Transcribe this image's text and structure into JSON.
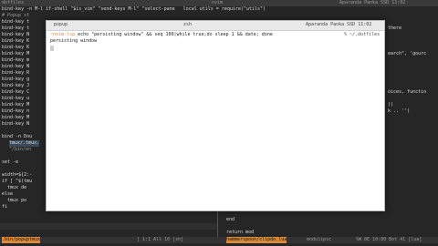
{
  "top_bar": {
    "left": "dotfiles",
    "center": "nvim",
    "right": "Aparanda Panka SSD 11:02"
  },
  "left_pane": [
    "bind-key -n M-l if-shell \"$is_vim\" \"send-keys M-l\" \"select-pane   local utils = require(\"utils\")",
    "# Popup st",
    "bind-key t",
    "bind-key t",
    "bind-key N",
    "bind-key K",
    "bind-key K",
    "bind-key M",
    "bind-key m",
    "bind-key N",
    "bind-key R",
    "bind-key g",
    "bind-key J",
    "bind-key C",
    "bind-key u",
    "bind-key M",
    "bind-key n",
    "bind-key M",
    "bind-key N",
    "",
    "bind -n Dou",
    "tmux/.tmux.",
    "\"/bin/en",
    "set -e",
    "width=${2:-",
    "if [ \"$(tmu",
    "  tmux de",
    "else",
    "  tmux po",
    "fi"
  ],
  "right_pane": [
    "there",
    "earch\", 'gourc",
    "oices, functio",
    "))",
    "k .. '')"
  ],
  "bottom_pane": [
    "end",
    "return mod"
  ],
  "status": {
    "left_mid": "",
    "left_pos": "",
    "bottom_left": ".bin/popuptmux",
    "bottom_left_pos": "[ 1:1 All 10 [sh]",
    "bottom_right": "hammerspoon/clipdo.lua",
    "bottom_right_mode": "modulipsc",
    "bottom_right_pos": "%W 8E 10:80 Bot 41 [lua]"
  },
  "popup": {
    "title": "popup",
    "shell": "zsh",
    "status": "Aparanda Panka SSD 11:02",
    "prompt": "~nvim-lsp",
    "command": "echo \"persisting window\" && seq 100|while true;do sleep 1 && date; done",
    "cwd": "% ~/.dotfiles",
    "output": "persisting window"
  }
}
